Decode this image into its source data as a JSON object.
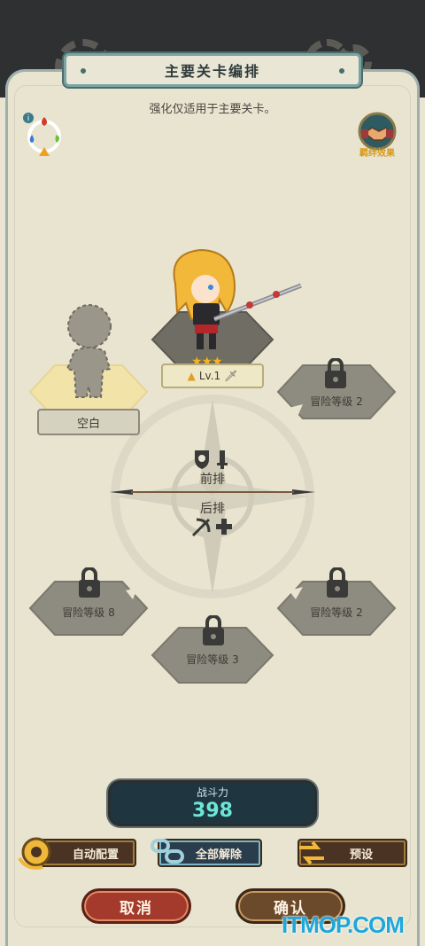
{
  "header": {
    "title": "主要关卡编排",
    "subtitle": "强化仅适用于主要关卡。"
  },
  "bond": {
    "label": "羁绊效果",
    "icon": "handshake-icon"
  },
  "element_wheel": {
    "icon": "element-wheel-icon",
    "info_icon": "info-icon"
  },
  "slots": {
    "front_empty": {
      "label": "空白"
    },
    "front_hero": {
      "level_label": "Lv.1",
      "stars": 3,
      "star_glyphs": "★★★"
    },
    "front_locked": {
      "label": "冒险等级 2"
    },
    "back_left": {
      "label": "冒险等级 8"
    },
    "back_center": {
      "label": "冒险等级 3"
    },
    "back_right": {
      "label": "冒险等级 2"
    }
  },
  "rows": {
    "front": "前排",
    "back": "后排"
  },
  "power": {
    "label": "战斗力",
    "value": "398"
  },
  "buttons": {
    "auto": "自动配置",
    "release_all": "全部解除",
    "preset": "预设",
    "cancel": "取消",
    "confirm": "确认"
  },
  "watermark": "ITMOP.COM",
  "colors": {
    "background": "#e8e4d0",
    "power_value": "#6ce6d8",
    "cancel": "#a33a2c",
    "confirm": "#6b4a2c",
    "star": "#f0b425",
    "bond_label": "#d79a1a"
  }
}
